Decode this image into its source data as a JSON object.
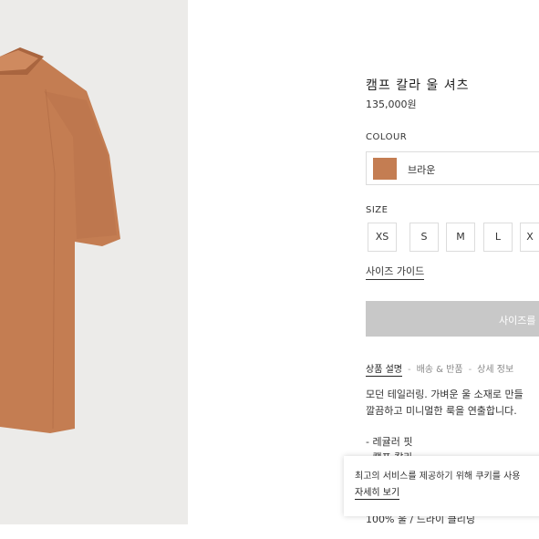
{
  "product": {
    "title": "캠프 칼라 울 셔츠",
    "price": "135,000원"
  },
  "colour": {
    "label": "COLOUR",
    "selected_name": "브라운",
    "selected_swatch": "#c47d52"
  },
  "size": {
    "label": "SIZE",
    "options": [
      "XS",
      "S",
      "M",
      "L",
      "X"
    ],
    "guide_link": "사이즈 가이드"
  },
  "cta": {
    "label": "사이즈를"
  },
  "tabs": [
    {
      "label": "상품 설명",
      "active": true
    },
    {
      "label": "배송 & 반품",
      "active": false
    },
    {
      "label": "상세 정보",
      "active": false
    }
  ],
  "description": {
    "line1": "모던 테일러링. 가벼운 울 소재로 만들",
    "line2": "깔끔하고 미니멀한 룩을 연출합니다.",
    "bullet1": "- 레귤러 핏",
    "bullet2": "- 캠프 칼라",
    "bullet_last": "100% 울 / 드라이 클리닝"
  },
  "cookie": {
    "message": "최고의 서비스를 제공하기 위해 쿠키를 사용",
    "link": "자세히 보기"
  },
  "colors": {
    "shirt": "#c47d52",
    "image_bg": "#ecebe9",
    "cta_bg": "#c8c8c8"
  }
}
